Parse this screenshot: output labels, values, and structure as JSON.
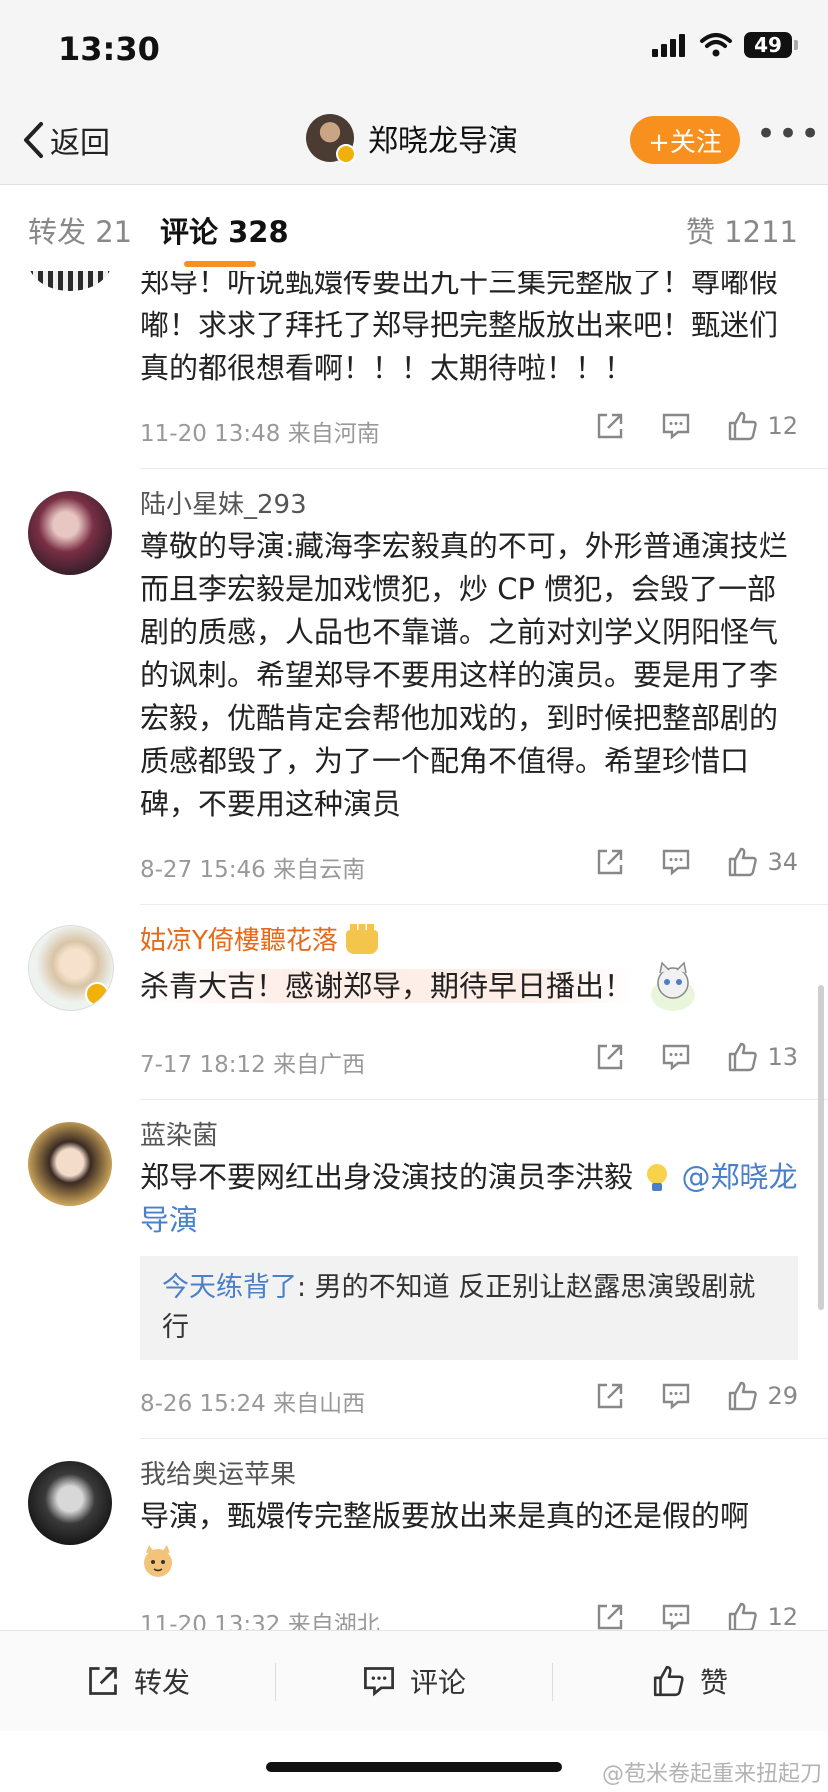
{
  "status_bar": {
    "time": "13:30",
    "battery": "49"
  },
  "nav": {
    "back_label": "返回",
    "title": "郑晓龙导演",
    "follow_label": "+关注",
    "more": "•••"
  },
  "tabs": {
    "forward": "转发 21",
    "comments": "评论 328",
    "likes": "赞 1211"
  },
  "comments": [
    {
      "text": "郑导！听说甄嬛传要出九十三集完整版了！尊嘟假嘟！求求了拜托了郑导把完整版放出来吧！甄迷们真的都很想看啊！！！太期待啦！！！",
      "meta": "11-20 13:48  来自河南",
      "likes": "12"
    },
    {
      "username": "陆小星妹_293",
      "text": "尊敬的导演:藏海李宏毅真的不可，外形普通演技烂而且李宏毅是加戏惯犯，炒 CP 惯犯，会毁了一部剧的质感，人品也不靠谱。之前对刘学义阴阳怪气的讽刺。希望郑导不要用这样的演员。要是用了李宏毅，优酷肯定会帮他加戏的，到时候把整部剧的质感都毁了，为了一个配角不值得。希望珍惜口碑，不要用这种演员",
      "meta": "8-27 15:46  来自云南",
      "likes": "34"
    },
    {
      "username": "姑凉Y倚樓聽花落",
      "text": "杀青大吉！感谢郑导，期待早日播出！",
      "meta": "7-17 18:12  来自广西",
      "likes": "13"
    },
    {
      "username": "蓝染菌",
      "text": "郑导不要网红出身没演技的演员李洪毅",
      "mention": "@郑晓龙导演",
      "quote_name": "今天练背了",
      "quote_text": ": 男的不知道 反正别让赵露思演毁剧就行",
      "meta": "8-26 15:24  来自山西",
      "likes": "29"
    },
    {
      "username": "我给奥运苹果",
      "text": "导演，甄嬛传完整版要放出来是真的还是假的啊",
      "meta": "11-20 13:32  来自湖北",
      "likes": "12"
    }
  ],
  "bottom_bar": {
    "forward": "转发",
    "comment": "评论",
    "like": "赞"
  },
  "watermark": "@苞米卷起重来扭起刀"
}
